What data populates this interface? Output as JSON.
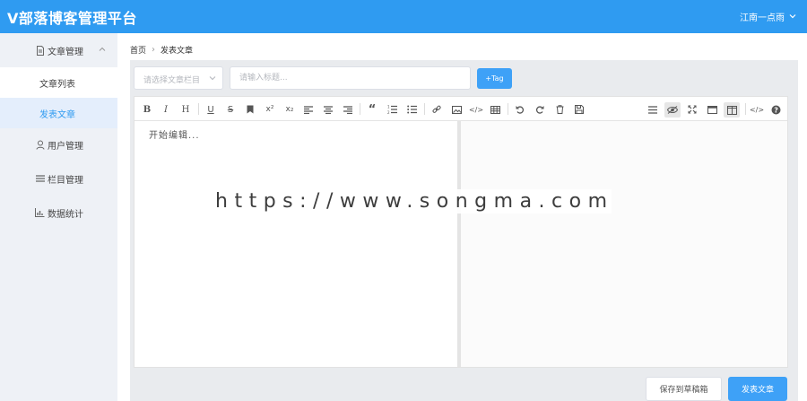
{
  "app": {
    "title": "V部落博客管理平台",
    "user": "江南一点雨"
  },
  "sidebar": {
    "groups": [
      {
        "label": "文章管理",
        "icon": "document-icon",
        "items": [
          {
            "label": "文章列表",
            "active": false
          },
          {
            "label": "发表文章",
            "active": true
          }
        ]
      },
      {
        "label": "用户管理",
        "icon": "user-icon"
      },
      {
        "label": "栏目管理",
        "icon": "list-icon"
      },
      {
        "label": "数据统计",
        "icon": "bar-chart-icon"
      }
    ]
  },
  "breadcrumb": {
    "home": "首页",
    "current": "发表文章"
  },
  "form": {
    "category_placeholder": "请选择文章栏目",
    "title_placeholder": "请输入标题...",
    "tag_button": "+Tag"
  },
  "editor": {
    "placeholder": "开始编辑...",
    "toolbar": [
      "bold",
      "italic",
      "header",
      "underline",
      "strikethrough",
      "mark",
      "superscript",
      "subscript",
      "align-left",
      "align-center",
      "align-right",
      "quote",
      "ordered-list",
      "unordered-list",
      "link",
      "image",
      "code",
      "table",
      "undo",
      "redo",
      "trash",
      "save",
      "navigation",
      "preview",
      "fullscreen",
      "read-mode",
      "subfield",
      "html-code",
      "help"
    ]
  },
  "actions": {
    "save_draft": "保存到草稿箱",
    "publish": "发表文章"
  },
  "watermark": "https://www.songma.com",
  "colors": {
    "primary": "#2f9bf1",
    "sidebar_bg": "#eef1f6",
    "content_bg": "#e9ebee"
  }
}
